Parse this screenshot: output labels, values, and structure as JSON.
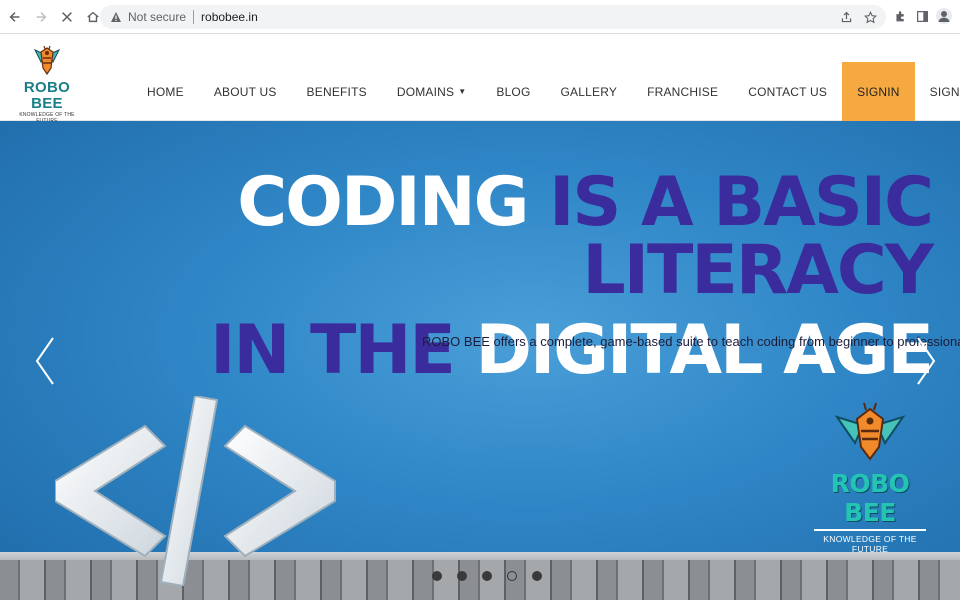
{
  "browser": {
    "status": "Not secure",
    "url": "robobee.in"
  },
  "logo": {
    "title": "ROBO BEE",
    "tagline": "KNOWLEDGE OF THE FUTURE"
  },
  "menu": [
    {
      "label": "HOME",
      "active": false
    },
    {
      "label": "ABOUT US",
      "active": false
    },
    {
      "label": "BENEFITS",
      "active": false
    },
    {
      "label": "DOMAINS",
      "active": false,
      "dropdown": true
    },
    {
      "label": "BLOG",
      "active": false
    },
    {
      "label": "GALLERY",
      "active": false
    },
    {
      "label": "FRANCHISE",
      "active": false
    },
    {
      "label": "CONTACT US",
      "active": false
    },
    {
      "label": "SIGNIN",
      "active": true
    },
    {
      "label": "SIGNUP",
      "active": false
    }
  ],
  "hero": {
    "headline": {
      "line1_white": "CODING",
      "line1_purple": "IS A BASIC LITERACY",
      "line2_purple": "IN THE",
      "line2_white": "DIGITAL AGE"
    },
    "subtitle": "ROBO BEE offers a complete, game-based suite to teach coding from beginner to professional level",
    "logo_title": "ROBO BEE",
    "logo_tagline": "KNOWLEDGE OF THE FUTURE",
    "slides_total": 5,
    "active_slide": 4
  },
  "colors": {
    "accent": "#f7a941",
    "brand_teal": "#1a7f86",
    "headline_purple": "#3a2c9c"
  }
}
